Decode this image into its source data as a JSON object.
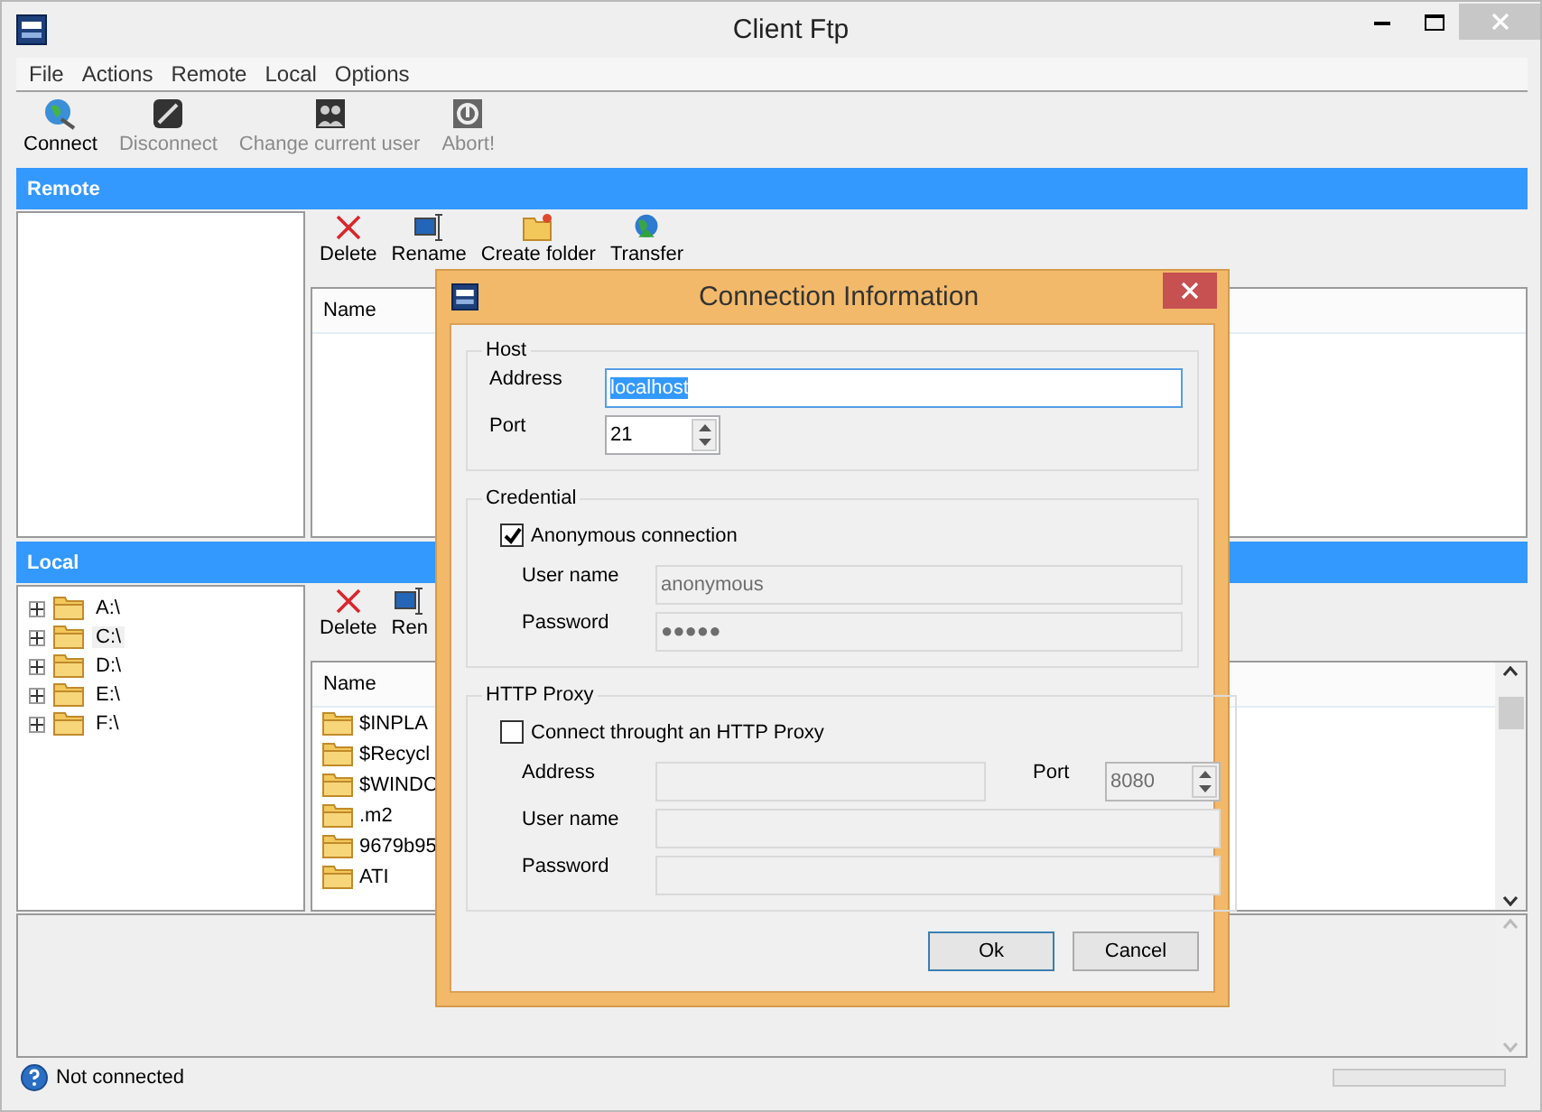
{
  "window": {
    "title": "Client Ftp"
  },
  "menu": [
    "File",
    "Actions",
    "Remote",
    "Local",
    "Options"
  ],
  "toolbar": [
    {
      "label": "Connect",
      "disabled": false
    },
    {
      "label": "Disconnect",
      "disabled": true
    },
    {
      "label": "Change current user",
      "disabled": true
    },
    {
      "label": "Abort!",
      "disabled": true
    }
  ],
  "remote": {
    "title": "Remote",
    "actions": [
      "Delete",
      "Rename",
      "Create folder",
      "Transfer"
    ],
    "columns": [
      "Name"
    ]
  },
  "local": {
    "title": "Local",
    "tree": [
      {
        "label": "A:\\",
        "selected": false
      },
      {
        "label": "C:\\",
        "selected": true
      },
      {
        "label": "D:\\",
        "selected": false
      },
      {
        "label": "E:\\",
        "selected": false
      },
      {
        "label": "F:\\",
        "selected": false
      }
    ],
    "actions": [
      "Delete",
      "Ren"
    ],
    "columns": [
      "Name"
    ],
    "rows": [
      "$INPLA",
      "$Recycl",
      "$WINDO",
      ".m2",
      "9679b95",
      "ATI"
    ]
  },
  "status_bar": {
    "text": "Not connected"
  },
  "dialog": {
    "title": "Connection Information",
    "host": {
      "title": "Host",
      "address_label": "Address",
      "address": "localhost",
      "port_label": "Port",
      "port": "21"
    },
    "credential": {
      "title": "Credential",
      "anonymous": {
        "label": "Anonymous connection",
        "checked": true
      },
      "user_label": "User name",
      "user": "anonymous",
      "password_label": "Password",
      "password": "●●●●●"
    },
    "proxy": {
      "title": "HTTP Proxy",
      "enabled": {
        "label": "Connect throught an HTTP Proxy",
        "checked": false
      },
      "address_label": "Address",
      "port_label": "Port",
      "port": "8080",
      "user_label": "User name",
      "password_label": "Password"
    },
    "buttons": [
      {
        "label": "Ok",
        "default": true
      },
      {
        "label": "Cancel",
        "default": false
      }
    ]
  }
}
